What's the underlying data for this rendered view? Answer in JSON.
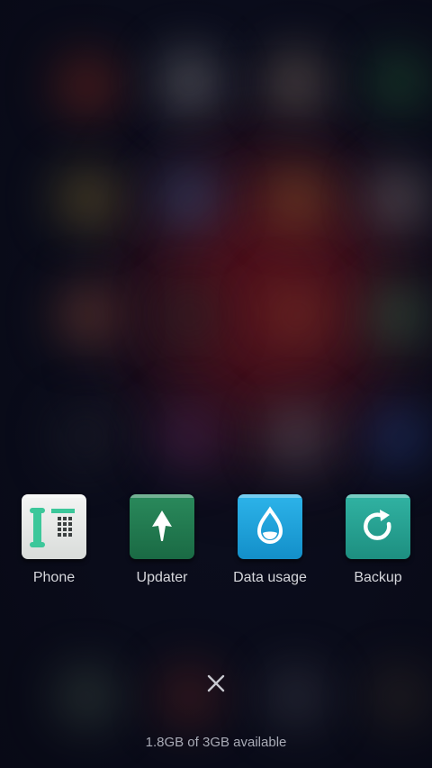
{
  "recent_apps": [
    {
      "label": "Phone",
      "icon": "phone-keypad-icon",
      "color": "#eceeed"
    },
    {
      "label": "Updater",
      "icon": "upload-arrow-icon",
      "color": "#1f7a4f"
    },
    {
      "label": "Data usage",
      "icon": "water-drop-icon",
      "color": "#1aa6e0"
    },
    {
      "label": "Backup",
      "icon": "refresh-backup-icon",
      "color": "#25a595"
    }
  ],
  "close_all": {
    "icon": "close-icon"
  },
  "memory": {
    "status_text": "1.8GB of 3GB available"
  }
}
